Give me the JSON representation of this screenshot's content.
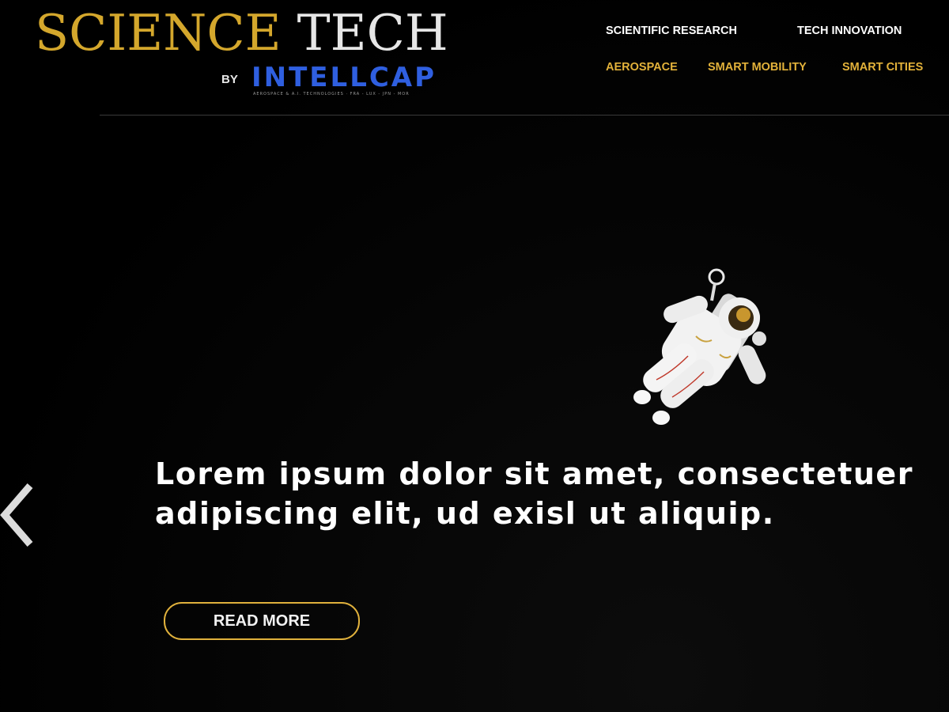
{
  "logo": {
    "science": "SCIENCE",
    "tech": "TECH",
    "by": "BY",
    "brand": "INTELLCAP",
    "tagline": "AEROSPACE & A.I. TECHNOLOGIES · FRA - LUX - JPN - MOR"
  },
  "nav": {
    "primary": [
      "SCIENTIFIC RESEARCH",
      "TECH INNOVATION"
    ],
    "secondary": [
      "AEROSPACE",
      "SMART MOBILITY",
      "SMART CITIES"
    ]
  },
  "hero": {
    "headline_line1": "Lorem ipsum dolor sit amet, consectetuer",
    "headline_line2": "adipiscing elit, ud exisl ut aliquip.",
    "cta_label": "READ MORE",
    "prev_icon": "chevron-left-icon",
    "image": "astronaut-image"
  },
  "colors": {
    "background": "#000000",
    "gold": "#d4a72c",
    "nav_gold": "#e3b23a",
    "brand_blue": "#2f5fe0",
    "text": "#ffffff"
  }
}
